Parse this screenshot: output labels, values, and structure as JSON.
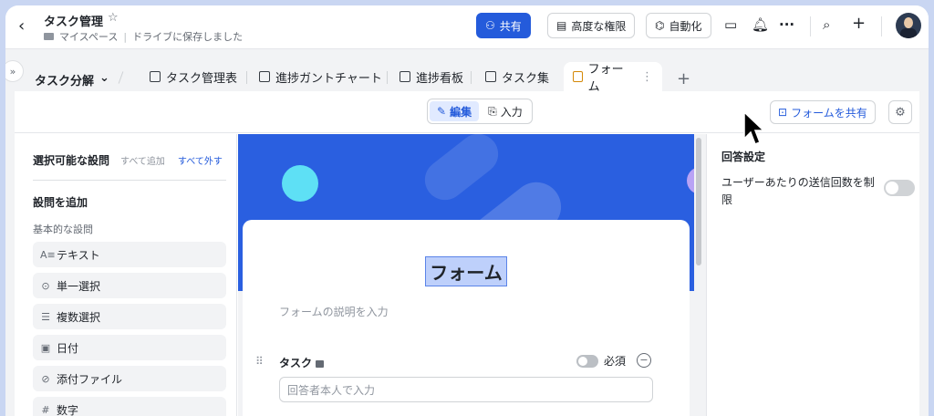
{
  "header": {
    "title": "タスク管理",
    "breadcrumb_location": "マイスペース",
    "breadcrumb_status": "ドライブに保存しました",
    "share_label": "共有",
    "permissions_label": "高度な権限",
    "automation_label": "自動化",
    "more_label": "···"
  },
  "tabs": {
    "group_label": "タスク分解",
    "items": [
      {
        "label": "タスク管理表"
      },
      {
        "label": "進捗ガントチャート"
      },
      {
        "label": "進捗看板"
      },
      {
        "label": "タスク集"
      },
      {
        "label": "フォーム"
      }
    ],
    "add_label": "+"
  },
  "toolbar": {
    "edit_label": "編集",
    "input_label": "入力",
    "share_form_label": "フォームを共有"
  },
  "left_panel": {
    "title": "選択可能な設問",
    "add_all": "すべて追加",
    "remove_all": "すべて外す",
    "section_title": "設問を追加",
    "subsection": "基本的な設問",
    "fields": [
      {
        "icon": "A≡",
        "label": "テキスト"
      },
      {
        "icon": "⊙",
        "label": "単一選択"
      },
      {
        "icon": "☰",
        "label": "複数選択"
      },
      {
        "icon": "▣",
        "label": "日付"
      },
      {
        "icon": "⊘",
        "label": "添付ファイル"
      },
      {
        "icon": "#",
        "label": "数字"
      }
    ]
  },
  "form": {
    "title": "フォーム",
    "description_placeholder": "フォームの説明を入力",
    "question": {
      "label": "タスク",
      "required_label": "必須",
      "input_placeholder": "回答者本人で入力"
    }
  },
  "right_panel": {
    "title": "回答設定",
    "limit_text": "ユーザーあたりの送信回数を制限"
  },
  "colors": {
    "accent": "#245bdb",
    "banner": "#2a5fe0"
  }
}
